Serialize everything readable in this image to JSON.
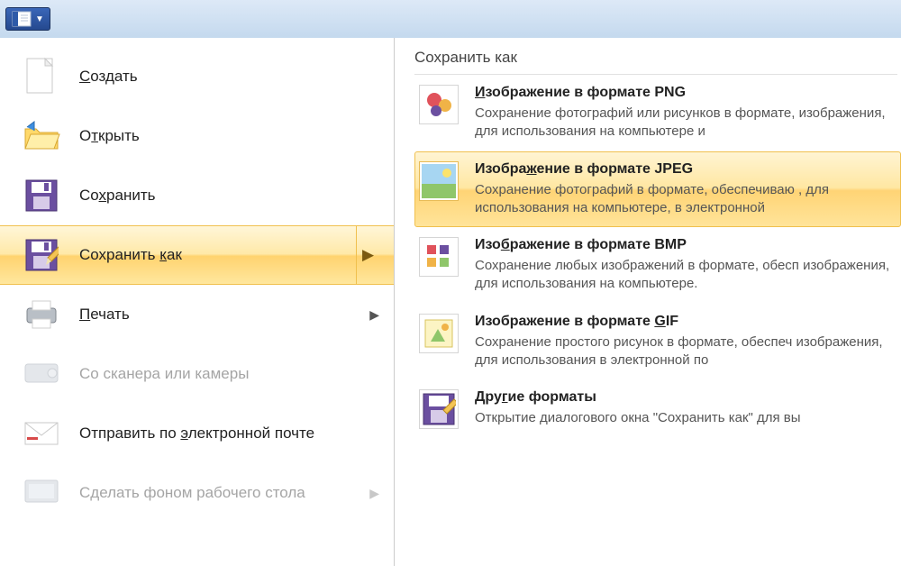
{
  "menu": {
    "items": [
      {
        "label_pre": "",
        "label_u": "С",
        "label_post": "оздать",
        "disabled": false,
        "arrow": false
      },
      {
        "label_pre": "О",
        "label_u": "т",
        "label_post": "крыть",
        "disabled": false,
        "arrow": false
      },
      {
        "label_pre": "Со",
        "label_u": "х",
        "label_post": "ранить",
        "disabled": false,
        "arrow": false
      },
      {
        "label_pre": "Сохранить ",
        "label_u": "к",
        "label_post": "ак",
        "disabled": false,
        "arrow": true,
        "selected": true
      },
      {
        "label_pre": "",
        "label_u": "П",
        "label_post": "ечать",
        "disabled": false,
        "arrow": true
      },
      {
        "label_pre": "Со сканера или камеры",
        "label_u": "",
        "label_post": "",
        "disabled": true,
        "arrow": false
      },
      {
        "label_pre": "Отправить по ",
        "label_u": "э",
        "label_post": "лектронной почте",
        "disabled": false,
        "arrow": false
      },
      {
        "label_pre": "Сделать фоном рабочего стола",
        "label_u": "",
        "label_post": "",
        "disabled": true,
        "arrow": true
      }
    ]
  },
  "right": {
    "title": "Сохранить как",
    "formats": [
      {
        "title_pre": "",
        "title_u": "И",
        "title_post": "зображение в формате PNG",
        "desc": "Сохранение фотографий или рисунков в формате, изображения, для использования на компьютере и"
      },
      {
        "title_pre": "Изобра",
        "title_u": "ж",
        "title_post": "ение в формате JPEG",
        "desc": "Сохранение фотографий в формате, обеспечиваю , для использования на компьютере, в электронной",
        "highlight": true
      },
      {
        "title_pre": "Изо",
        "title_u": "б",
        "title_post": "ражение в формате BMP",
        "desc": "Сохранение любых изображений в формате, обесп изображения, для использования на компьютере."
      },
      {
        "title_pre": "Изображение в формате ",
        "title_u": "G",
        "title_post": "IF",
        "desc": "Сохранение простого рисунок в формате, обеспеч изображения, для использования в электронной по"
      },
      {
        "title_pre": "Дру",
        "title_u": "г",
        "title_post": "ие форматы",
        "desc": "Открытие диалогового окна \"Сохранить как\" для вы"
      }
    ]
  }
}
